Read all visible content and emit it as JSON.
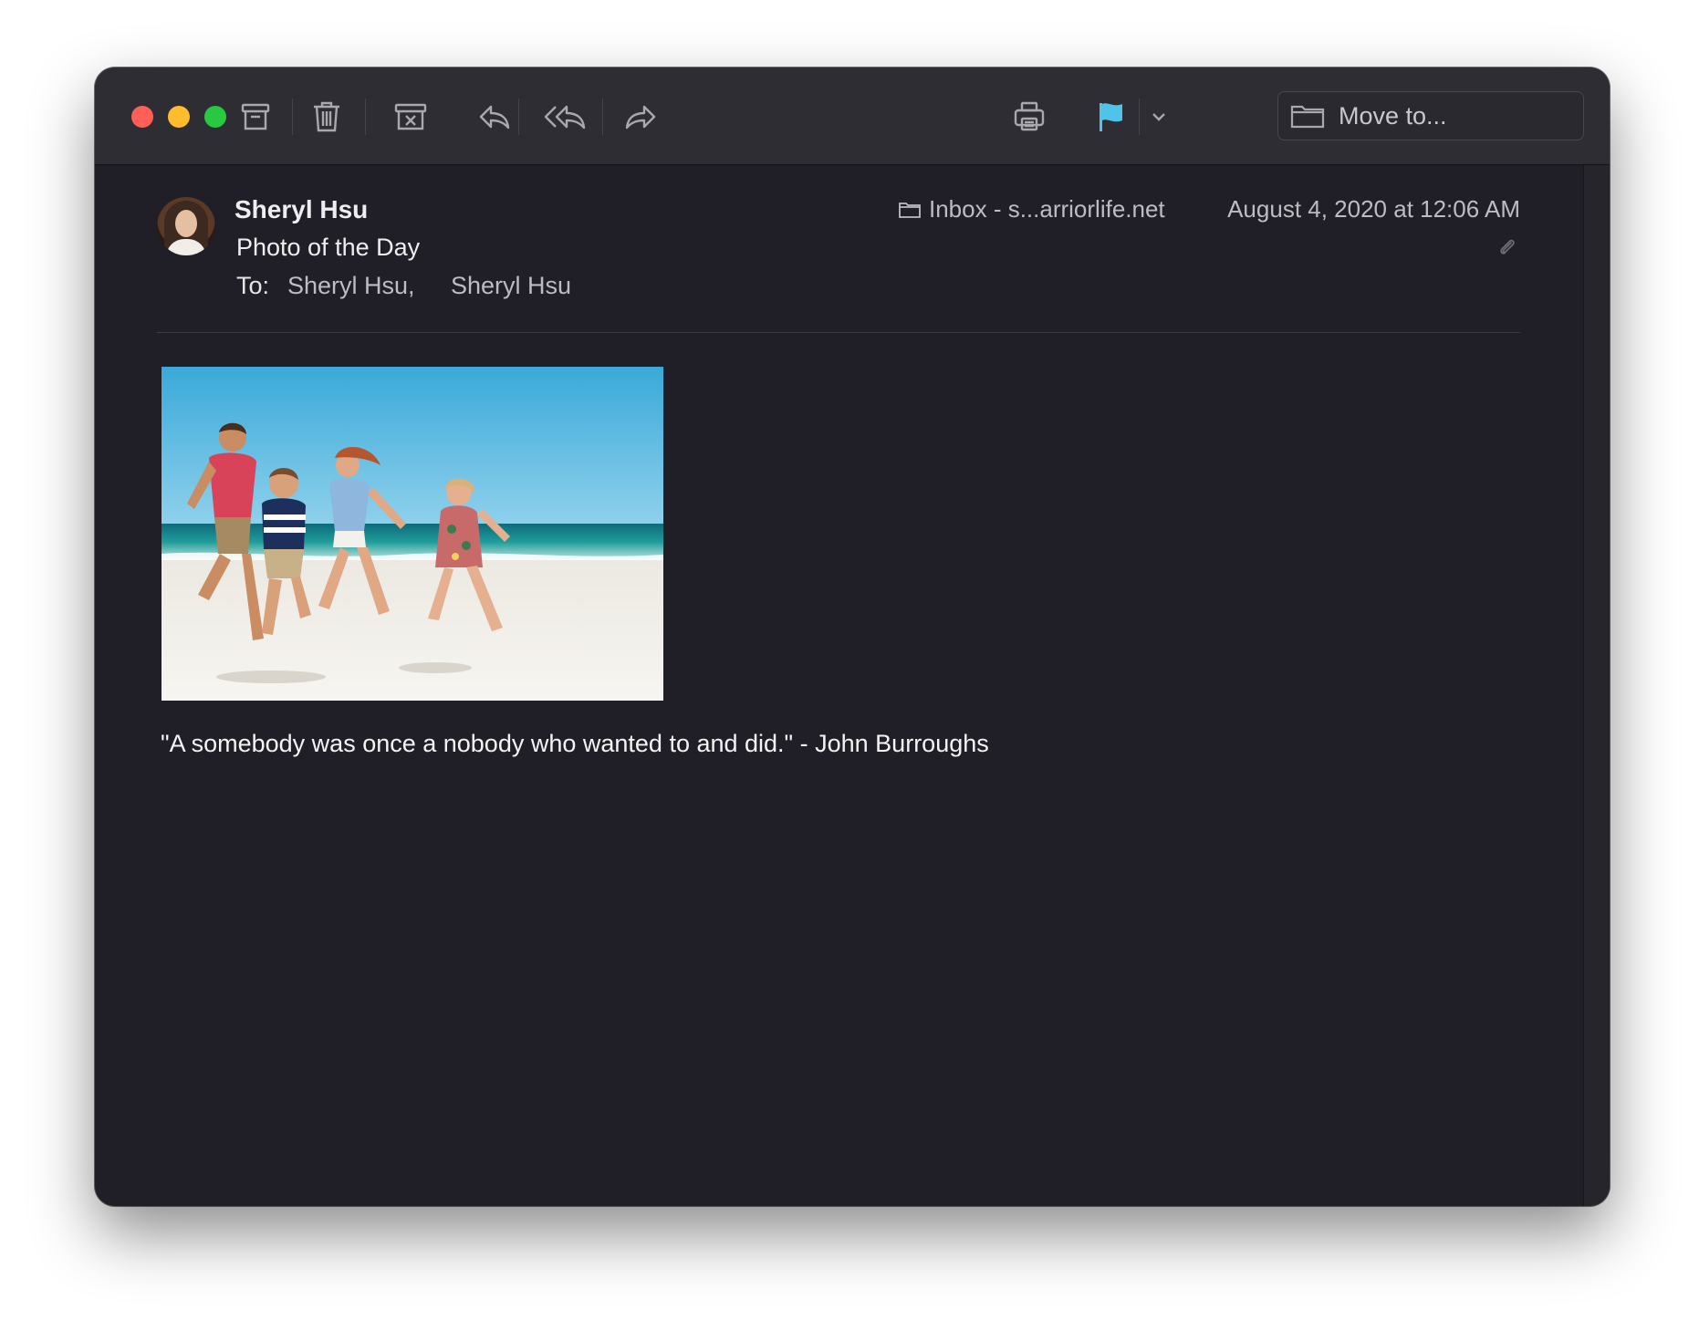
{
  "toolbar": {
    "move_to_label": "Move to...",
    "flag_color": "#4fc3e8"
  },
  "message": {
    "sender": "Sheryl Hsu",
    "subject": "Photo of the Day",
    "to_label": "To:",
    "recipients": [
      "Sheryl Hsu,",
      "Sheryl Hsu"
    ],
    "mailbox": "Inbox - s...arriorlife.net",
    "date": "August 4, 2020 at 12:06 AM",
    "quote": "\"A somebody was once a nobody who wanted to and did.\" - John Burroughs"
  }
}
